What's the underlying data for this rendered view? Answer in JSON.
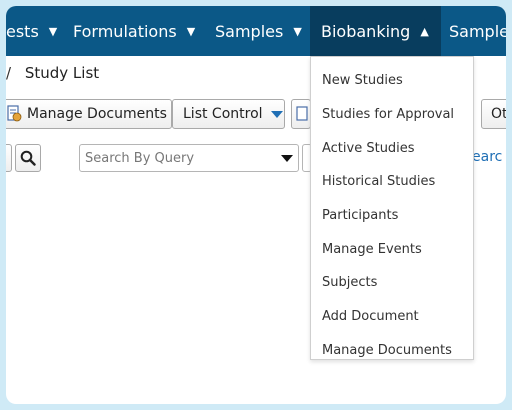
{
  "nav": {
    "items": [
      "ests",
      "Formulations",
      "Samples",
      "Biobanking",
      "Sample"
    ],
    "active": "Biobanking"
  },
  "breadcrumb": {
    "separator": "/",
    "current": "Study List"
  },
  "toolbar": {
    "manage_documents": "Manage Documents",
    "list_control": "List Control",
    "right_partial": "Ot"
  },
  "search": {
    "query_placeholder": "Search By Query",
    "search_link_partial": "earc"
  },
  "biobanking_menu": [
    "New Studies",
    "Studies for Approval",
    "Active Studies",
    "Historical Studies",
    "Participants",
    "Manage Events",
    "Subjects",
    "Add Document",
    "Manage Documents"
  ],
  "colors": {
    "navbar": "#0b5887",
    "navbar_active": "#083d5e",
    "accent_link": "#1f6fb5"
  },
  "icons": [
    "caret-down-icon",
    "caret-up-icon",
    "document-icon",
    "search-icon"
  ]
}
